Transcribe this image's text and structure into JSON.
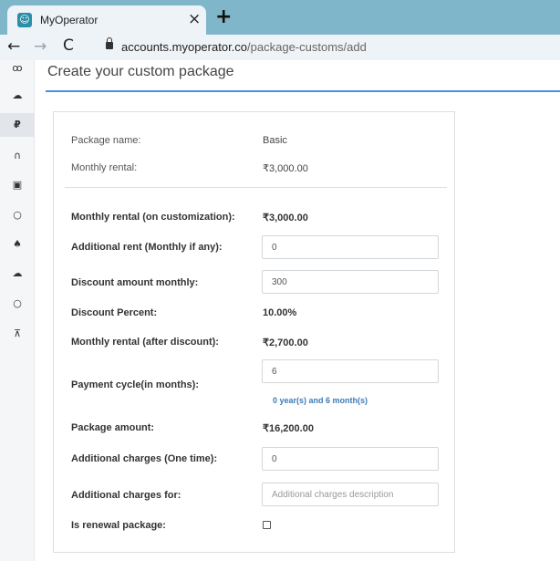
{
  "browser": {
    "tab_title": "MyOperator",
    "favicon_glyph": "☺",
    "close_glyph": "×",
    "new_tab_glyph": "+",
    "url_host": "accounts.myoperator.co",
    "url_path": "/package-customs/add",
    "back_glyph": "←",
    "forward_glyph": "→",
    "reload_glyph": "C"
  },
  "sidebar": {
    "icons": [
      {
        "name": "group-icon",
        "glyph": "ꝏ"
      },
      {
        "name": "cloud-icon",
        "glyph": "☁"
      },
      {
        "name": "rupee-icon",
        "glyph": "₽"
      },
      {
        "name": "headset-icon",
        "glyph": "∩"
      },
      {
        "name": "billing-icon",
        "glyph": "▣"
      },
      {
        "name": "circle-icon",
        "glyph": "○"
      },
      {
        "name": "bell-icon",
        "glyph": "♠"
      },
      {
        "name": "cloud-sync-icon",
        "glyph": "☁"
      },
      {
        "name": "circle-icon-2",
        "glyph": "○"
      },
      {
        "name": "cart-icon",
        "glyph": "⊼"
      }
    ],
    "active_index": 2
  },
  "page": {
    "title": "Create your custom package",
    "accent_color": "#4a90e2"
  },
  "form": {
    "package_name_label": "Package name:",
    "package_name_value": "Basic",
    "monthly_rental_label": "Monthly rental:",
    "monthly_rental_value": "₹3,000.00",
    "rental_customization_label": "Monthly rental (on customization):",
    "rental_customization_value": "₹3,000.00",
    "additional_rent_label": "Additional rent (Monthly if any):",
    "additional_rent_value": "0",
    "discount_amount_label": "Discount amount monthly:",
    "discount_amount_value": "300",
    "discount_percent_label": "Discount Percent:",
    "discount_percent_value": "10.00%",
    "rental_after_discount_label": "Monthly rental (after discount):",
    "rental_after_discount_value": "₹2,700.00",
    "payment_cycle_label": "Payment cycle(in months):",
    "payment_cycle_value": "6",
    "payment_cycle_hint": "0 year(s) and 6 month(s)",
    "package_amount_label": "Package amount:",
    "package_amount_value": "₹16,200.00",
    "additional_charges_label": "Additional charges (One time):",
    "additional_charges_value": "0",
    "additional_charges_for_label": "Additional charges for:",
    "additional_charges_for_placeholder": "Additional charges description",
    "is_renewal_label": "Is renewal package:",
    "is_renewal_checked": false
  }
}
